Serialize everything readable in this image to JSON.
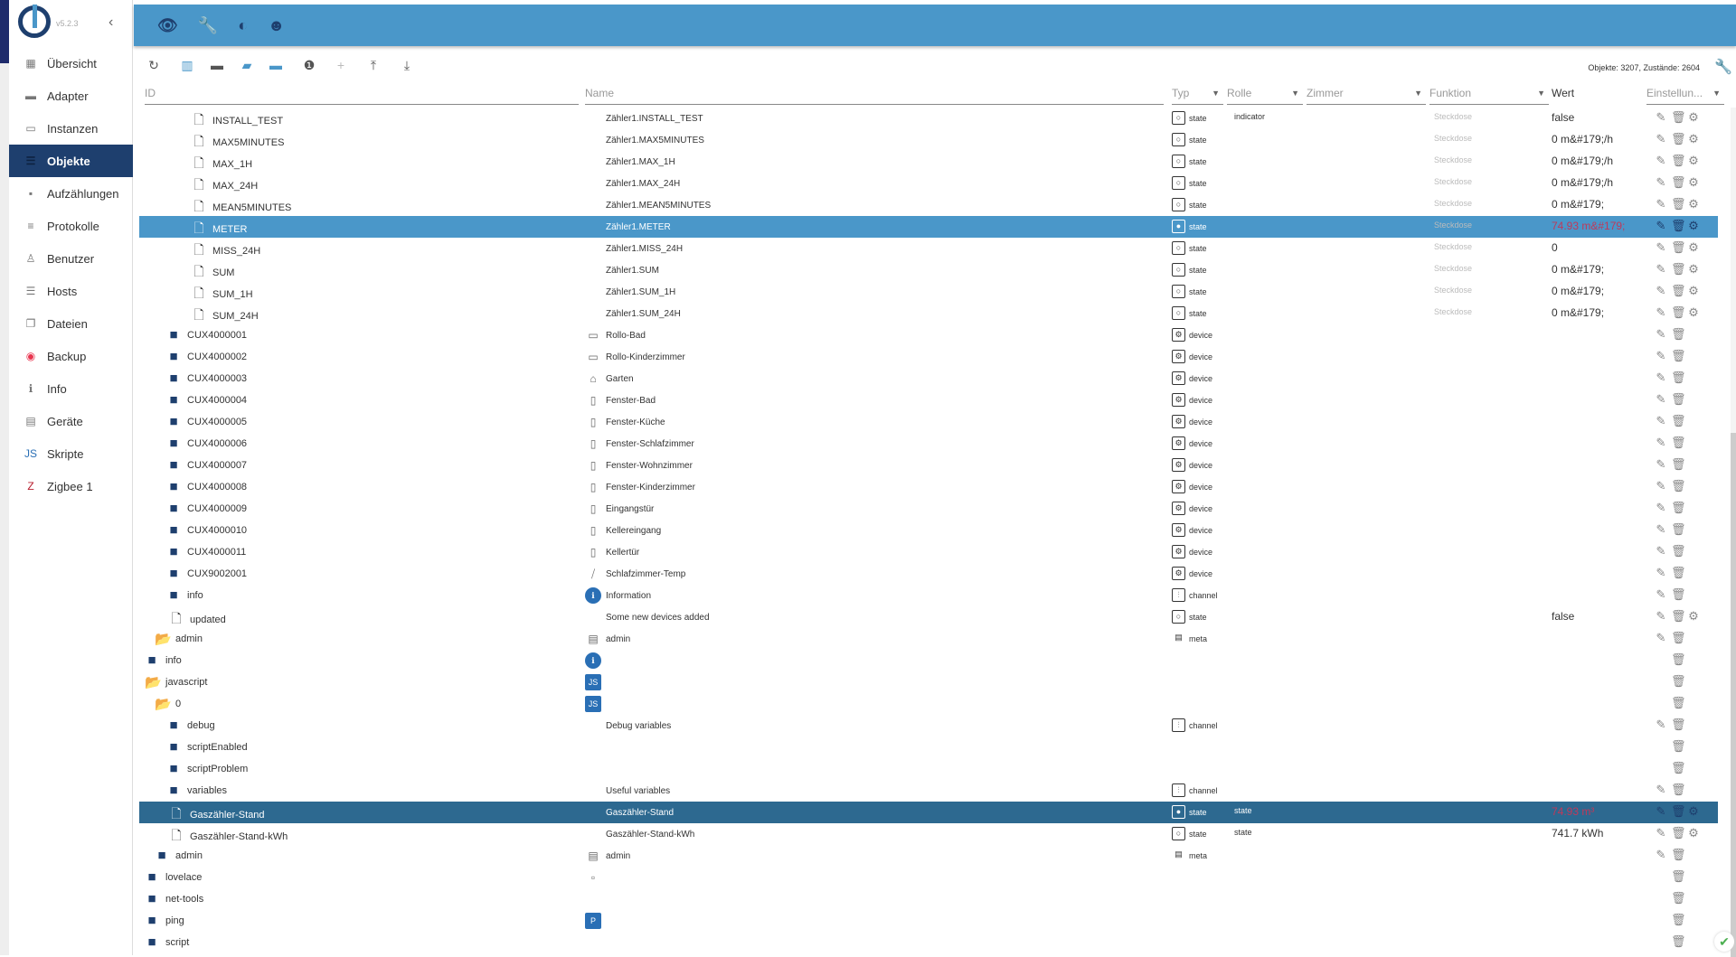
{
  "app": {
    "version": "v5.2.3"
  },
  "sidebar": {
    "items": [
      {
        "label": "Übersicht",
        "icon": "apps-icon",
        "glyph": "▦"
      },
      {
        "label": "Adapter",
        "icon": "store-icon",
        "glyph": "▬"
      },
      {
        "label": "Instanzen",
        "icon": "instances-icon",
        "glyph": "▭"
      },
      {
        "label": "Objekte",
        "icon": "list-icon",
        "glyph": "☰",
        "active": true
      },
      {
        "label": "Aufzählungen",
        "icon": "enum-icon",
        "glyph": "▪"
      },
      {
        "label": "Protokolle",
        "icon": "log-icon",
        "glyph": "≡"
      },
      {
        "label": "Benutzer",
        "icon": "user-icon",
        "glyph": "♙"
      },
      {
        "label": "Hosts",
        "icon": "hosts-icon",
        "glyph": "☰"
      },
      {
        "label": "Dateien",
        "icon": "files-icon",
        "glyph": "❐"
      },
      {
        "label": "Backup",
        "icon": "backup-icon",
        "glyph": "◉",
        "color": "#e8354f"
      },
      {
        "label": "Info",
        "icon": "info-icon",
        "glyph": "ℹ"
      },
      {
        "label": "Geräte",
        "icon": "devices-icon",
        "glyph": "▤"
      },
      {
        "label": "Skripte",
        "icon": "js-icon",
        "glyph": "JS",
        "color": "#2a6fb5"
      },
      {
        "label": "Zigbee 1",
        "icon": "zigbee-icon",
        "glyph": "Z",
        "color": "#b71c2c"
      }
    ]
  },
  "toolbar": {
    "counts": "Objekte: 3207, Zustände: 2604"
  },
  "columns": {
    "id": "ID",
    "name": "Name",
    "type": "Typ",
    "role": "Rolle",
    "room": "Zimmer",
    "function": "Funktion",
    "value": "Wert",
    "settings": "Einstellun..."
  },
  "rows": [
    {
      "id": "INSTALL_TEST",
      "kind": "file",
      "level": 3,
      "name": "Zähler1.INSTALL_TEST",
      "type": "state",
      "role": "indicator",
      "func": "Steckdose",
      "value": "false",
      "actions": 3
    },
    {
      "id": "MAX5MINUTES",
      "kind": "file",
      "level": 3,
      "name": "Zähler1.MAX5MINUTES",
      "type": "state",
      "func": "Steckdose",
      "value": "0 m&#179;/h",
      "actions": 3
    },
    {
      "id": "MAX_1H",
      "kind": "file",
      "level": 3,
      "name": "Zähler1.MAX_1H",
      "type": "state",
      "func": "Steckdose",
      "value": "0 m&#179;/h",
      "actions": 3
    },
    {
      "id": "MAX_24H",
      "kind": "file",
      "level": 3,
      "name": "Zähler1.MAX_24H",
      "type": "state",
      "func": "Steckdose",
      "value": "0 m&#179;/h",
      "actions": 3
    },
    {
      "id": "MEAN5MINUTES",
      "kind": "file",
      "level": 3,
      "name": "Zähler1.MEAN5MINUTES",
      "type": "state",
      "func": "Steckdose",
      "value": "0 m&#179;",
      "actions": 3
    },
    {
      "id": "METER",
      "kind": "file",
      "level": 3,
      "name": "Zähler1.METER",
      "type": "state",
      "func": "Steckdose",
      "value": "74.93 m&#179;",
      "valueRed": true,
      "actions": 3,
      "selected": 1
    },
    {
      "id": "MISS_24H",
      "kind": "file",
      "level": 3,
      "name": "Zähler1.MISS_24H",
      "type": "state",
      "func": "Steckdose",
      "value": "0",
      "actions": 3
    },
    {
      "id": "SUM",
      "kind": "file",
      "level": 3,
      "name": "Zähler1.SUM",
      "type": "state",
      "func": "Steckdose",
      "value": "0 m&#179;",
      "actions": 3
    },
    {
      "id": "SUM_1H",
      "kind": "file",
      "level": 3,
      "name": "Zähler1.SUM_1H",
      "type": "state",
      "func": "Steckdose",
      "value": "0 m&#179;",
      "actions": 3
    },
    {
      "id": "SUM_24H",
      "kind": "file",
      "level": 3,
      "name": "Zähler1.SUM_24H",
      "type": "state",
      "func": "Steckdose",
      "value": "0 m&#179;",
      "actions": 3
    },
    {
      "id": "CUX4000001",
      "kind": "folder",
      "level": 2,
      "name": "Rollo-Bad",
      "nameIcon": "▭",
      "type": "device",
      "actions": 2
    },
    {
      "id": "CUX4000002",
      "kind": "folder",
      "level": 2,
      "name": "Rollo-Kinderzimmer",
      "nameIcon": "▭",
      "type": "device",
      "actions": 2
    },
    {
      "id": "CUX4000003",
      "kind": "folder",
      "level": 2,
      "name": "Garten",
      "nameIcon": "⌂",
      "type": "device",
      "actions": 2
    },
    {
      "id": "CUX4000004",
      "kind": "folder",
      "level": 2,
      "name": "Fenster-Bad",
      "nameIcon": "▯",
      "type": "device",
      "actions": 2
    },
    {
      "id": "CUX4000005",
      "kind": "folder",
      "level": 2,
      "name": "Fenster-Küche",
      "nameIcon": "▯",
      "type": "device",
      "actions": 2
    },
    {
      "id": "CUX4000006",
      "kind": "folder",
      "level": 2,
      "name": "Fenster-Schlafzimmer",
      "nameIcon": "▯",
      "type": "device",
      "actions": 2
    },
    {
      "id": "CUX4000007",
      "kind": "folder",
      "level": 2,
      "name": "Fenster-Wohnzimmer",
      "nameIcon": "▯",
      "type": "device",
      "actions": 2
    },
    {
      "id": "CUX4000008",
      "kind": "folder",
      "level": 2,
      "name": "Fenster-Kinderzimmer",
      "nameIcon": "▯",
      "type": "device",
      "actions": 2
    },
    {
      "id": "CUX4000009",
      "kind": "folder",
      "level": 2,
      "name": "Eingangstür",
      "nameIcon": "▯",
      "type": "device",
      "actions": 2
    },
    {
      "id": "CUX4000010",
      "kind": "folder",
      "level": 2,
      "name": "Kellereingang",
      "nameIcon": "▯",
      "type": "device",
      "actions": 2
    },
    {
      "id": "CUX4000011",
      "kind": "folder",
      "level": 2,
      "name": "Kellertür",
      "nameIcon": "▯",
      "type": "device",
      "actions": 2
    },
    {
      "id": "CUX9002001",
      "kind": "folder",
      "level": 2,
      "name": "Schlafzimmer-Temp",
      "nameIcon": "⧸",
      "type": "device",
      "actions": 2
    },
    {
      "id": "info",
      "kind": "folder",
      "level": 2,
      "name": "Information",
      "nameIcon": "ℹ",
      "type": "channel",
      "actions": 2
    },
    {
      "id": "updated",
      "kind": "file",
      "level": 2,
      "name": "Some new devices added",
      "type": "state",
      "value": "false",
      "actions": 3
    },
    {
      "id": "admin",
      "kind": "open",
      "level": 1,
      "name": "admin",
      "nameIcon": "▤",
      "type": "meta",
      "actions": 2
    },
    {
      "id": "info",
      "kind": "folder",
      "level": 0,
      "nameIcon": "ℹ",
      "actions": 1
    },
    {
      "id": "javascript",
      "kind": "open",
      "level": 0,
      "nameIcon": "JS",
      "actions": 1
    },
    {
      "id": "0",
      "kind": "open",
      "level": 1,
      "nameIcon": "JS",
      "actions": 1
    },
    {
      "id": "debug",
      "kind": "folder",
      "level": 2,
      "name": "Debug variables",
      "type": "channel",
      "actions": 2
    },
    {
      "id": "scriptEnabled",
      "kind": "folder",
      "level": 2,
      "actions": 1
    },
    {
      "id": "scriptProblem",
      "kind": "folder",
      "level": 2,
      "actions": 1
    },
    {
      "id": "variables",
      "kind": "folder",
      "level": 2,
      "name": "Useful variables",
      "type": "channel",
      "actions": 2
    },
    {
      "id": "Gaszähler-Stand",
      "kind": "file",
      "level": 2,
      "name": "Gaszähler-Stand",
      "type": "state",
      "role": "state",
      "value": "74.93 m³",
      "valueRed": true,
      "actions": 3,
      "selected": 2
    },
    {
      "id": "Gaszähler-Stand-kWh",
      "kind": "file",
      "level": 2,
      "name": "Gaszähler-Stand-kWh",
      "type": "state",
      "role": "state",
      "value": "741.7 kWh",
      "actions": 3
    },
    {
      "id": "admin",
      "kind": "folder",
      "level": 1,
      "name": "admin",
      "nameIcon": "▤",
      "type": "meta",
      "actions": 2
    },
    {
      "id": "lovelace",
      "kind": "folder",
      "level": 0,
      "nameIcon": "▫",
      "actions": 1
    },
    {
      "id": "net-tools",
      "kind": "folder",
      "level": 0,
      "actions": 1
    },
    {
      "id": "ping",
      "kind": "folder",
      "level": 0,
      "nameIcon": "P",
      "actions": 1
    },
    {
      "id": "script",
      "kind": "folder",
      "level": 0,
      "actions": 1
    }
  ]
}
